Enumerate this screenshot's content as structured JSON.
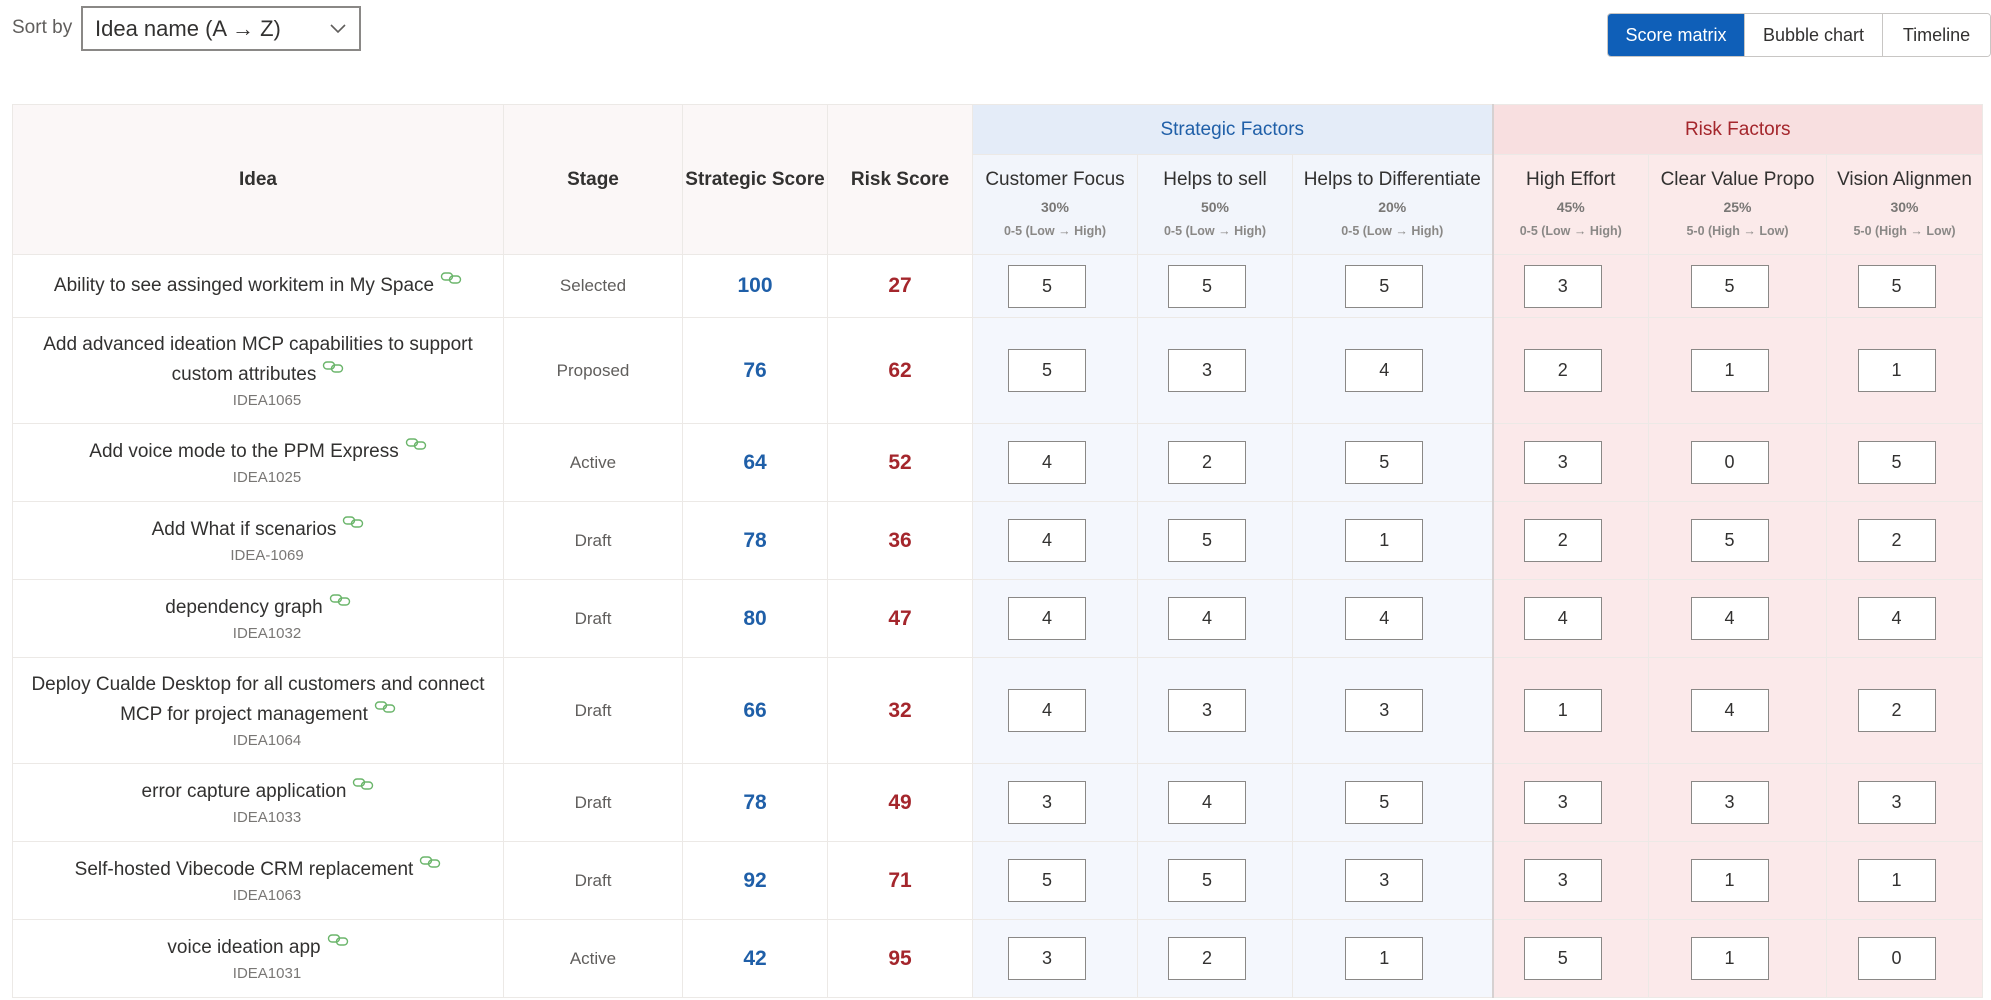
{
  "sort": {
    "label": "Sort by",
    "selected": "Idea name (A → Z)"
  },
  "views": [
    {
      "label": "Score matrix",
      "active": true
    },
    {
      "label": "Bubble chart",
      "active": false
    },
    {
      "label": "Timeline",
      "active": false
    }
  ],
  "headers": {
    "idea": "Idea",
    "stage": "Stage",
    "strategic_score": "Strategic Score",
    "risk_score": "Risk Score",
    "strategic_group": "Strategic Factors",
    "risk_group": "Risk Factors"
  },
  "factors": [
    {
      "name": "Customer Focus",
      "weight": "30%",
      "scale": "0-5 (Low → High)",
      "group": "strategic"
    },
    {
      "name": "Helps to sell",
      "weight": "50%",
      "scale": "0-5 (Low → High)",
      "group": "strategic"
    },
    {
      "name": "Helps to Differentiate",
      "weight": "20%",
      "scale": "0-5 (Low → High)",
      "group": "strategic"
    },
    {
      "name": "High Effort",
      "weight": "45%",
      "scale": "0-5 (Low → High)",
      "group": "risk"
    },
    {
      "name": "Clear Value Propo",
      "weight": "25%",
      "scale": "5-0 (High → Low)",
      "group": "risk"
    },
    {
      "name": "Vision Alignmen",
      "weight": "30%",
      "scale": "5-0 (High → Low)",
      "group": "risk"
    }
  ],
  "rows": [
    {
      "lines": [
        "Ability to see assinged workitem in My Space"
      ],
      "code": "",
      "stage": "Selected",
      "strategic": "100",
      "risk": "27",
      "scores": [
        "5",
        "5",
        "5",
        "3",
        "5",
        "5"
      ]
    },
    {
      "lines": [
        "Add advanced ideation MCP capabilities to support",
        "custom attributes"
      ],
      "code": "IDEA1065",
      "stage": "Proposed",
      "strategic": "76",
      "risk": "62",
      "scores": [
        "5",
        "3",
        "4",
        "2",
        "1",
        "1"
      ]
    },
    {
      "lines": [
        "Add voice mode to the PPM Express"
      ],
      "code": "IDEA1025",
      "stage": "Active",
      "strategic": "64",
      "risk": "52",
      "scores": [
        "4",
        "2",
        "5",
        "3",
        "0",
        "5"
      ]
    },
    {
      "lines": [
        "Add What if scenarios"
      ],
      "code": "IDEA-1069",
      "stage": "Draft",
      "strategic": "78",
      "risk": "36",
      "scores": [
        "4",
        "5",
        "1",
        "2",
        "5",
        "2"
      ]
    },
    {
      "lines": [
        "dependency graph"
      ],
      "code": "IDEA1032",
      "stage": "Draft",
      "strategic": "80",
      "risk": "47",
      "scores": [
        "4",
        "4",
        "4",
        "4",
        "4",
        "4"
      ]
    },
    {
      "lines": [
        "Deploy Cualde Desktop for all customers and connect",
        "MCP for project management"
      ],
      "code": "IDEA1064",
      "stage": "Draft",
      "strategic": "66",
      "risk": "32",
      "scores": [
        "4",
        "3",
        "3",
        "1",
        "4",
        "2"
      ]
    },
    {
      "lines": [
        "error capture application"
      ],
      "code": "IDEA1033",
      "stage": "Draft",
      "strategic": "78",
      "risk": "49",
      "scores": [
        "3",
        "4",
        "5",
        "3",
        "3",
        "3"
      ]
    },
    {
      "lines": [
        "Self-hosted Vibecode CRM replacement"
      ],
      "code": "IDEA1063",
      "stage": "Draft",
      "strategic": "92",
      "risk": "71",
      "scores": [
        "5",
        "5",
        "3",
        "3",
        "1",
        "1"
      ]
    },
    {
      "lines": [
        "voice ideation app"
      ],
      "code": "IDEA1031",
      "stage": "Active",
      "strategic": "42",
      "risk": "95",
      "scores": [
        "3",
        "2",
        "1",
        "5",
        "1",
        "0"
      ]
    }
  ],
  "icons": {
    "chevron": "chevron-down-icon",
    "link": "link-icon"
  },
  "colors": {
    "accent": "#0f5fb8",
    "strategic": "#1f5fa8",
    "risk": "#a4262c",
    "link_icon": "#6bb56b"
  }
}
